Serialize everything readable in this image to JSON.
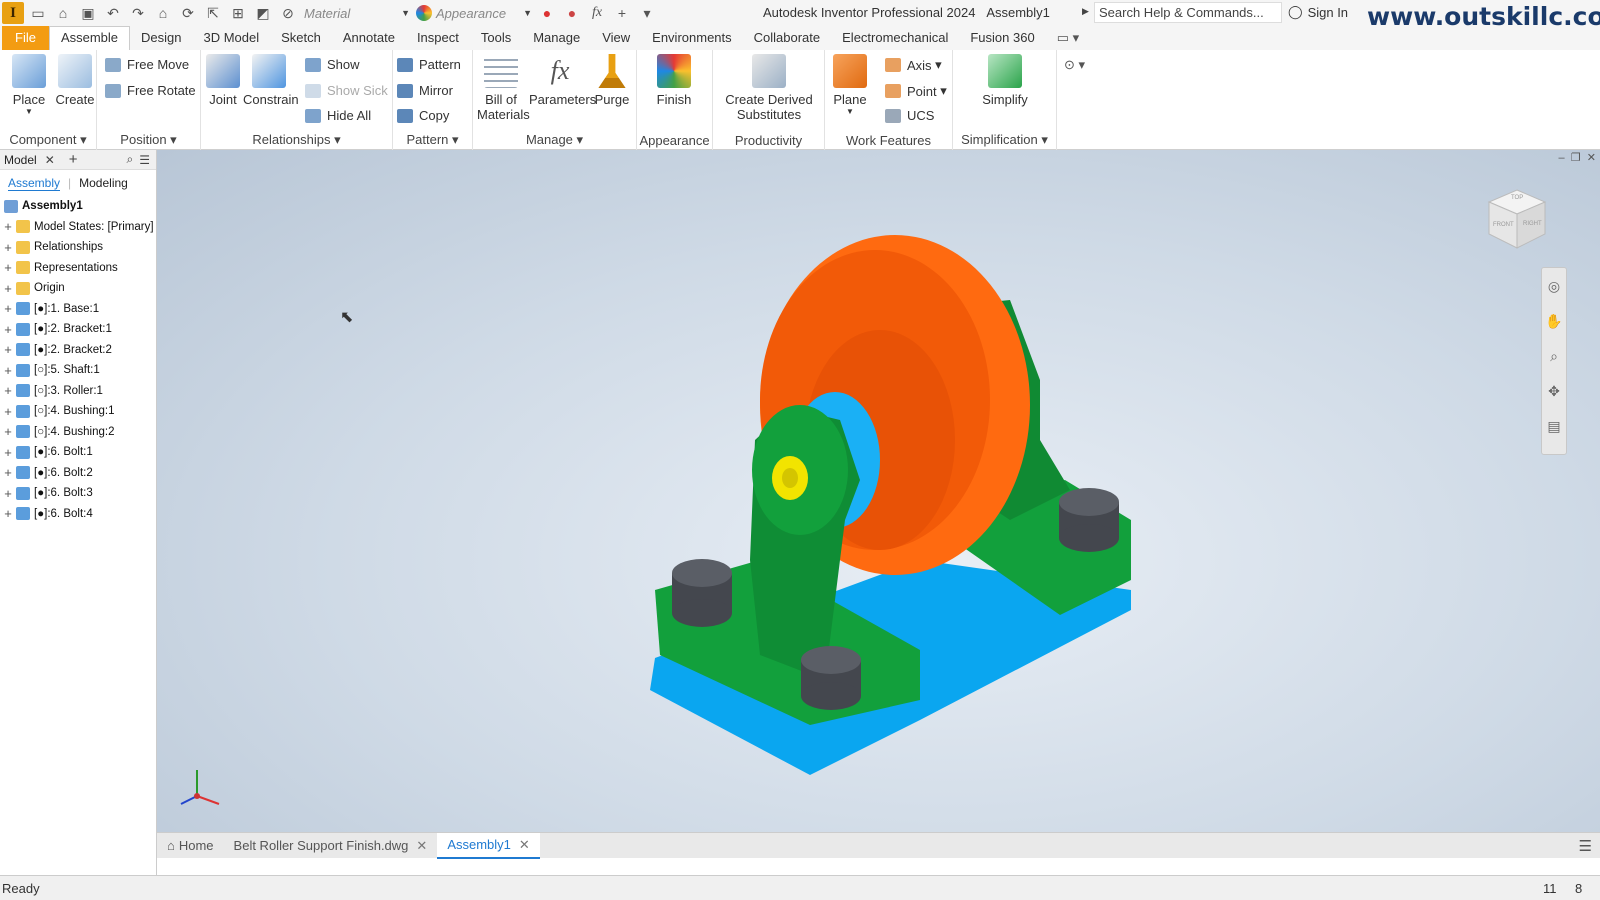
{
  "app": {
    "logo_letter": "I",
    "title": "Autodesk Inventor Professional 2024",
    "document": "Assembly1",
    "search_placeholder": "Search Help & Commands...",
    "sign_in": "Sign In",
    "watermark": "www.outskillc.com"
  },
  "qat": {
    "material_placeholder": "Material",
    "appearance_placeholder": "Appearance"
  },
  "ribbon_tabs": [
    "File",
    "Assemble",
    "Design",
    "3D Model",
    "Sketch",
    "Annotate",
    "Inspect",
    "Tools",
    "Manage",
    "View",
    "Environments",
    "Collaborate",
    "Electromechanical",
    "Fusion 360"
  ],
  "ribbon": {
    "component": {
      "title": "Component",
      "place": "Place",
      "create": "Create"
    },
    "position": {
      "title": "Position",
      "free_move": "Free Move",
      "free_rotate": "Free Rotate"
    },
    "relationships": {
      "title": "Relationships",
      "joint": "Joint",
      "constrain": "Constrain",
      "show": "Show",
      "show_sick": "Show Sick",
      "hide_all": "Hide All"
    },
    "pattern": {
      "title": "Pattern",
      "pattern": "Pattern",
      "mirror": "Mirror",
      "copy": "Copy"
    },
    "manage": {
      "title": "Manage",
      "bom_line1": "Bill of",
      "bom_line2": "Materials",
      "parameters": "Parameters",
      "purge": "Purge"
    },
    "appearance": {
      "title": "Appearance",
      "finish": "Finish"
    },
    "productivity": {
      "title": "Productivity",
      "cds_line1": "Create Derived",
      "cds_line2": "Substitutes"
    },
    "work_features": {
      "title": "Work Features",
      "plane": "Plane",
      "axis": "Axis",
      "point": "Point",
      "ucs": "UCS"
    },
    "simplification": {
      "title": "Simplification",
      "simplify": "Simplify"
    }
  },
  "browser": {
    "tab": "Model",
    "sub_tabs": [
      "Assembly",
      "Modeling"
    ],
    "root": "Assembly1",
    "items": [
      "Model States: [Primary]",
      "Relationships",
      "Representations",
      "Origin",
      "[●]:1. Base:1",
      "[●]:2. Bracket:1",
      "[●]:2. Bracket:2",
      "[○]:5. Shaft:1",
      "[○]:3. Roller:1",
      "[○]:4. Bushing:1",
      "[○]:4. Bushing:2",
      "[●]:6. Bolt:1",
      "[●]:6. Bolt:2",
      "[●]:6. Bolt:3",
      "[●]:6. Bolt:4"
    ]
  },
  "viewcube": {
    "top": "TOP",
    "front": "FRONT",
    "right": "RIGHT"
  },
  "doc_tabs": [
    "Home",
    "Belt Roller Support Finish.dwg",
    "Assembly1"
  ],
  "status": {
    "text": "Ready",
    "count1": "11",
    "count2": "8"
  },
  "colors": {
    "file_tab": "#f39c12",
    "base": "#0aa6f0",
    "bracket": "#12a03c",
    "roller": "#ff6a10",
    "bolt": "#4a4d55",
    "bushing": "#f2e400",
    "active_tab": "#1f7ad1"
  }
}
